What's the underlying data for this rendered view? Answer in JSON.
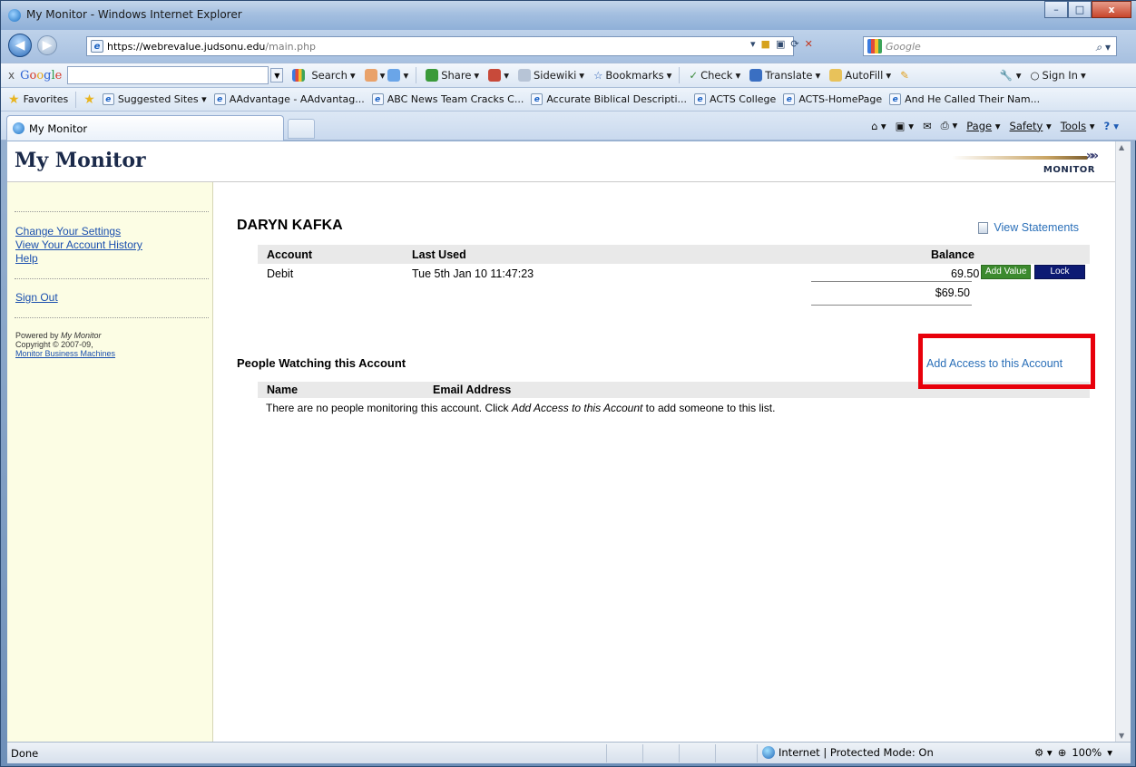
{
  "window": {
    "title": "My Monitor - Windows Internet Explorer",
    "buttons": {
      "minimize": "–",
      "maximize": "□",
      "close": "x"
    }
  },
  "browser": {
    "address_host": "https://webrevalue.judsonu.edu",
    "address_path": "/main.php",
    "search_placeholder": "Google",
    "google_toolbar": {
      "logo": [
        "G",
        "o",
        "o",
        "g",
        "l",
        "e"
      ],
      "items": [
        "Search",
        "Share",
        "Sidewiki",
        "Bookmarks",
        "Check",
        "Translate",
        "AutoFill"
      ],
      "sign_in": "Sign In"
    },
    "favorites": {
      "label": "Favorites",
      "items": [
        "Suggested Sites ▾",
        "AAdvantage - AAdvantag...",
        "ABC News Team Cracks C...",
        "Accurate Biblical Descripti...",
        "ACTS College",
        "ACTS-HomePage",
        "And He Called Their Nam..."
      ]
    },
    "tab_title": "My Monitor",
    "command_bar": {
      "page": "Page",
      "safety": "Safety",
      "tools": "Tools"
    },
    "status": {
      "text": "Done",
      "zone": "Internet | Protected Mode: On",
      "zoom": "100%"
    }
  },
  "app": {
    "title": "My Monitor",
    "logo_text": "MONITOR"
  },
  "sidebar": {
    "links": [
      "Change Your Settings",
      "View Your Account History",
      "Help"
    ],
    "sign_out": "Sign Out",
    "powered_prefix": "Powered by ",
    "powered_name": "My Monitor",
    "copyright": "Copyright © 2007-09,",
    "company": "Monitor Business Machines"
  },
  "main": {
    "user_name": "DARYN KAFKA",
    "view_statements": "View Statements",
    "accounts": {
      "headers": {
        "account": "Account",
        "last_used": "Last Used",
        "balance": "Balance"
      },
      "rows": [
        {
          "account": "Debit",
          "last_used": "Tue 5th Jan 10 11:47:23",
          "balance": "69.50"
        }
      ],
      "add_value_label": "Add Value",
      "lock_label": "Lock",
      "total": "$69.50"
    },
    "people": {
      "heading": "People Watching this Account",
      "add_access": "Add Access to this Account",
      "headers": {
        "name": "Name",
        "email": "Email Address"
      },
      "empty_pre": "There are no people monitoring this account. Click ",
      "empty_link": "Add Access to this Account",
      "empty_post": " to add someone to this list."
    }
  }
}
